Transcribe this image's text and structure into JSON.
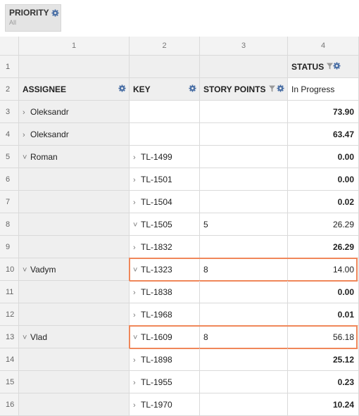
{
  "filter": {
    "label": "PRIORITY",
    "value": "All"
  },
  "col_numbers": [
    "1",
    "2",
    "3",
    "4"
  ],
  "headers": {
    "status": "STATUS",
    "assignee": "ASSIGNEE",
    "key": "KEY",
    "story_points": "STORY POINTS",
    "status_value": "In Progress"
  },
  "rows": [
    {
      "n": "3",
      "assignee": "Oleksandr",
      "assignee_exp": "collapsed",
      "key": "",
      "key_exp": "",
      "sp": "",
      "val": "73.90",
      "bold": true
    },
    {
      "n": "4",
      "assignee": "Oleksandr",
      "assignee_exp": "collapsed",
      "key": "",
      "key_exp": "",
      "sp": "",
      "val": "63.47",
      "bold": true
    },
    {
      "n": "5",
      "assignee": "Roman",
      "assignee_exp": "expanded",
      "key": "TL-1499",
      "key_exp": "collapsed",
      "sp": "",
      "val": "0.00",
      "bold": true
    },
    {
      "n": "6",
      "assignee": "",
      "assignee_exp": "",
      "key": "TL-1501",
      "key_exp": "collapsed",
      "sp": "",
      "val": "0.00",
      "bold": true
    },
    {
      "n": "7",
      "assignee": "",
      "assignee_exp": "",
      "key": "TL-1504",
      "key_exp": "collapsed",
      "sp": "",
      "val": "0.02",
      "bold": true
    },
    {
      "n": "8",
      "assignee": "",
      "assignee_exp": "",
      "key": "TL-1505",
      "key_exp": "expanded",
      "sp": "5",
      "val": "26.29",
      "bold": false
    },
    {
      "n": "9",
      "assignee": "",
      "assignee_exp": "",
      "key": "TL-1832",
      "key_exp": "collapsed",
      "sp": "",
      "val": "26.29",
      "bold": true
    },
    {
      "n": "10",
      "assignee": "Vadym",
      "assignee_exp": "expanded",
      "key": "TL-1323",
      "key_exp": "expanded",
      "sp": "8",
      "val": "14.00",
      "bold": false
    },
    {
      "n": "11",
      "assignee": "",
      "assignee_exp": "",
      "key": "TL-1838",
      "key_exp": "collapsed",
      "sp": "",
      "val": "0.00",
      "bold": true
    },
    {
      "n": "12",
      "assignee": "",
      "assignee_exp": "",
      "key": "TL-1968",
      "key_exp": "collapsed",
      "sp": "",
      "val": "0.01",
      "bold": true
    },
    {
      "n": "13",
      "assignee": "Vlad",
      "assignee_exp": "expanded",
      "key": "TL-1609",
      "key_exp": "expanded",
      "sp": "8",
      "val": "56.18",
      "bold": false
    },
    {
      "n": "14",
      "assignee": "",
      "assignee_exp": "",
      "key": "TL-1898",
      "key_exp": "collapsed",
      "sp": "",
      "val": "25.12",
      "bold": true
    },
    {
      "n": "15",
      "assignee": "",
      "assignee_exp": "",
      "key": "TL-1955",
      "key_exp": "collapsed",
      "sp": "",
      "val": "0.23",
      "bold": true
    },
    {
      "n": "16",
      "assignee": "",
      "assignee_exp": "",
      "key": "TL-1970",
      "key_exp": "collapsed",
      "sp": "",
      "val": "10.24",
      "bold": true
    }
  ],
  "highlighted_rows": [
    "10",
    "13"
  ],
  "colors": {
    "highlight": "#f0875a",
    "header_bg": "#efefef",
    "grid_line": "#dadada"
  },
  "icons": {
    "settings": "gear-icon",
    "filter": "funnel-icon",
    "expand": "chevron-right-icon",
    "collapse": "chevron-down-icon"
  }
}
